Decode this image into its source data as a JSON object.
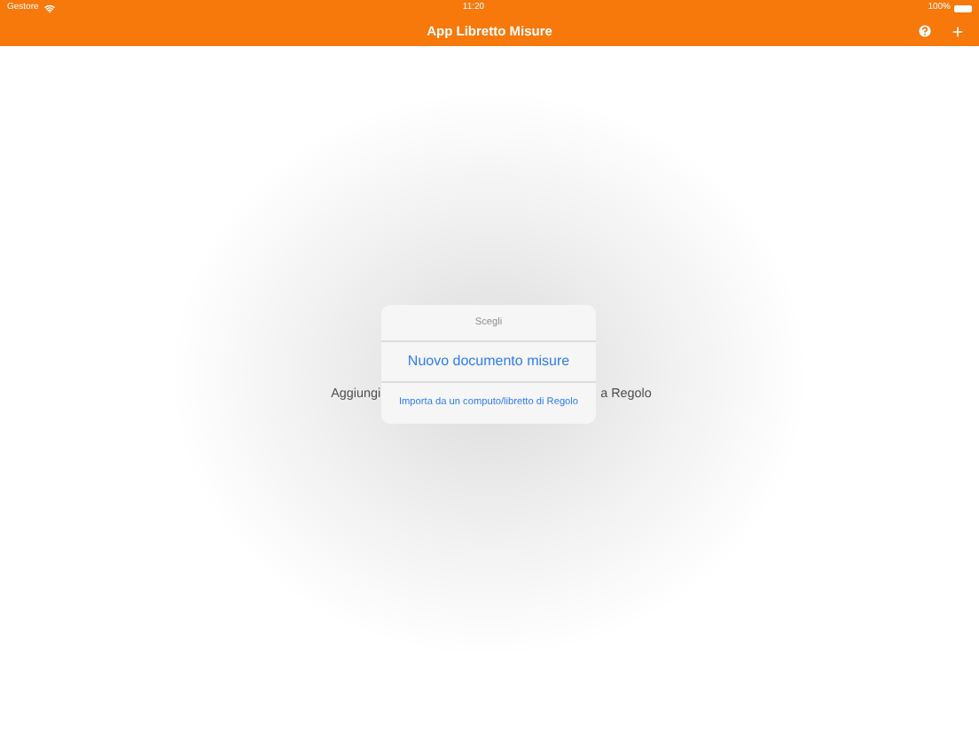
{
  "status_bar": {
    "carrier": "Gestore",
    "time": "11:20",
    "battery": "100%"
  },
  "nav_bar": {
    "title": "App Libretto Misure"
  },
  "background_text": [
    "Aggiungi",
    "a Regolo"
  ],
  "popover": {
    "title": "Scegli",
    "actions": [
      {
        "label": "Nuovo documento misure",
        "kind": "primary"
      },
      {
        "label": "Importa da un computo/libretto di Regolo",
        "kind": "secondary"
      }
    ]
  }
}
